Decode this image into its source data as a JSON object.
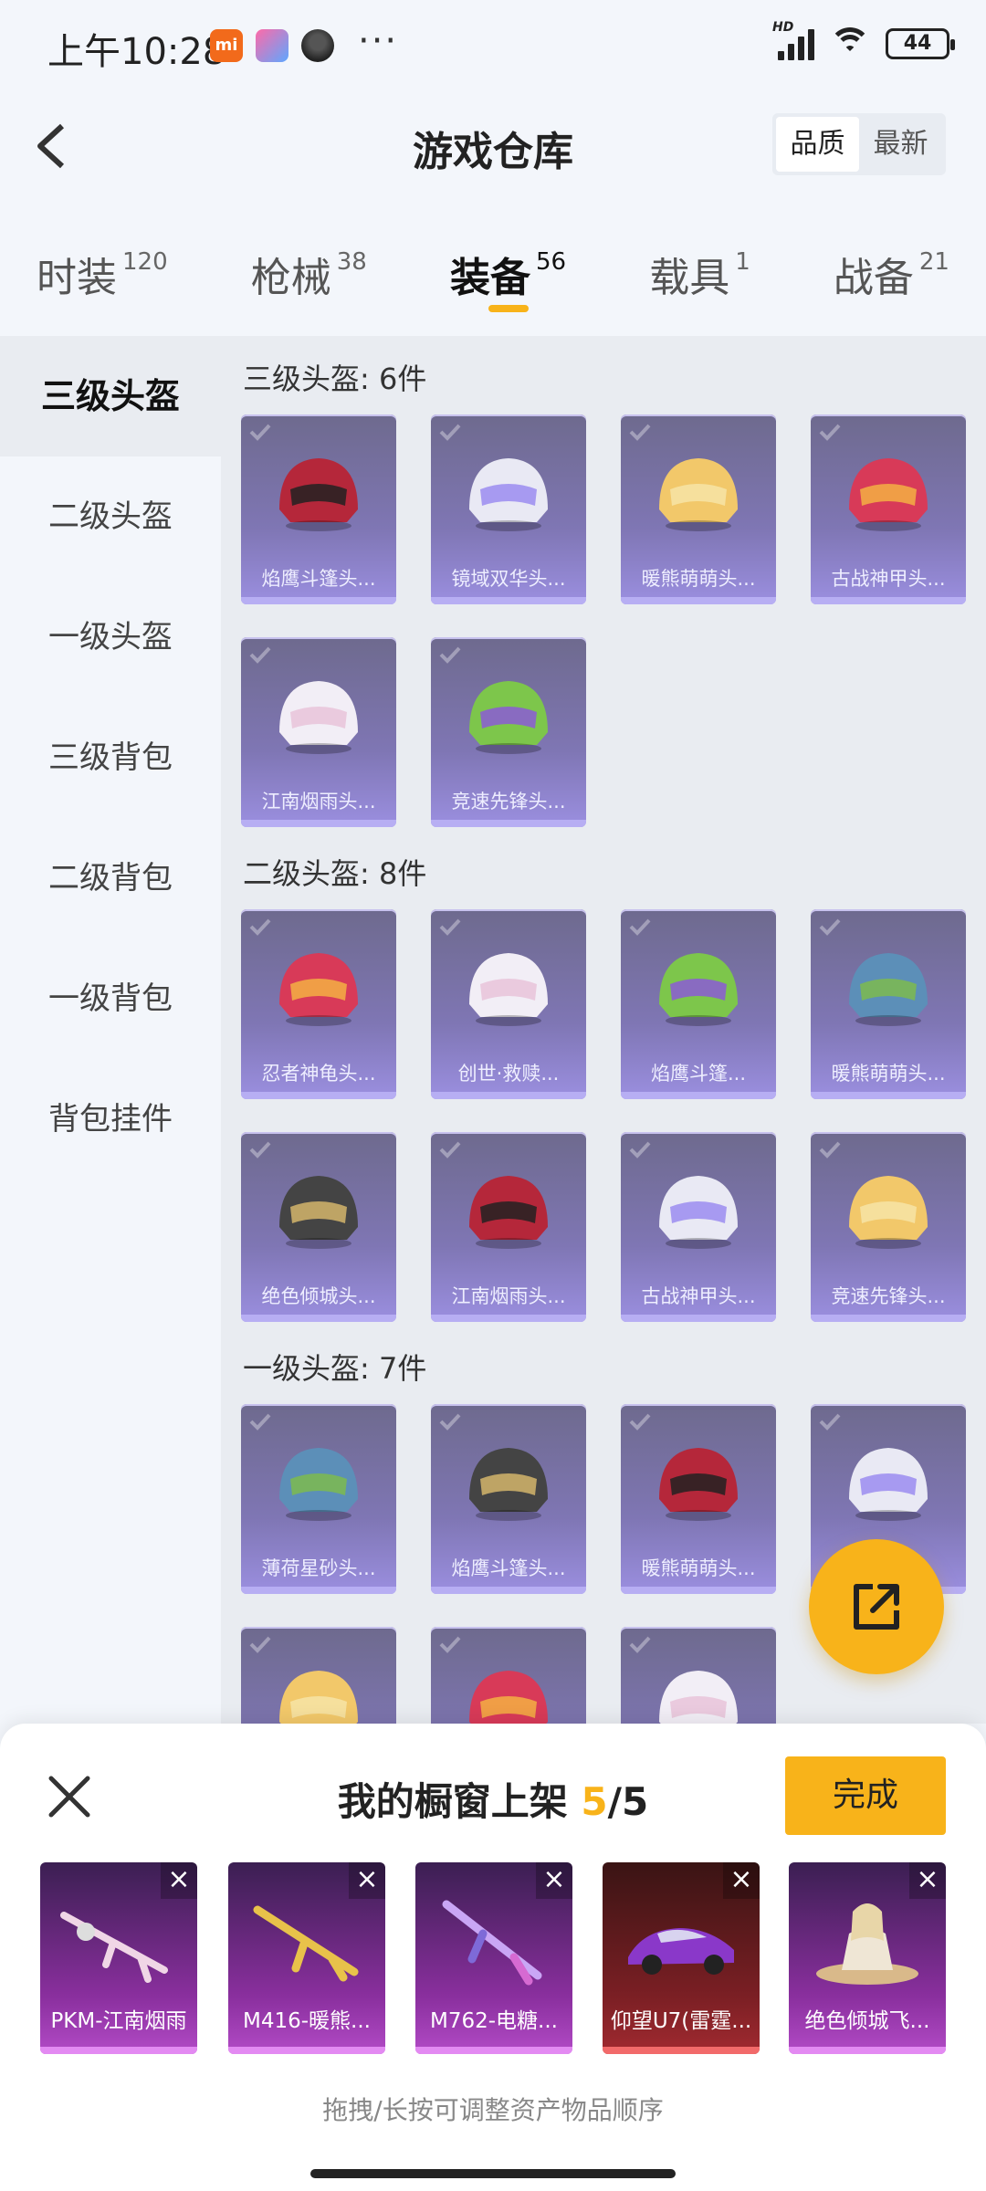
{
  "status_bar": {
    "time": "上午10:28",
    "dots": "···",
    "network_label": "HD",
    "battery": "44"
  },
  "header": {
    "title": "游戏仓库",
    "sort_options": [
      "品质",
      "最新"
    ],
    "sort_selected": "品质"
  },
  "tabs": [
    {
      "label": "时装",
      "count": "120"
    },
    {
      "label": "枪械",
      "count": "38"
    },
    {
      "label": "装备",
      "count": "56",
      "active": true
    },
    {
      "label": "载具",
      "count": "1"
    },
    {
      "label": "战备",
      "count": "21"
    }
  ],
  "sidebar": {
    "items": [
      "三级头盔",
      "二级头盔",
      "一级头盔",
      "三级背包",
      "二级背包",
      "一级背包",
      "背包挂件"
    ],
    "active": "三级头盔"
  },
  "sections": [
    {
      "title": "三级头盔: 6件",
      "items": [
        "焰鹰斗篷头...",
        "镜域双华头...",
        "暖熊萌萌头...",
        "古战神甲头...",
        "江南烟雨头...",
        "竞速先锋头..."
      ]
    },
    {
      "title": "二级头盔: 8件",
      "items": [
        "忍者神龟头...",
        "创世·救赎...",
        "焰鹰斗篷...",
        "暖熊萌萌头...",
        "绝色倾城头...",
        "江南烟雨头...",
        "古战神甲头...",
        "竞速先锋头..."
      ]
    },
    {
      "title": "一级头盔: 7件",
      "items": [
        "薄荷星砂头...",
        "焰鹰斗篷头...",
        "暖熊萌萌头...",
        "",
        "",
        "",
        ""
      ]
    }
  ],
  "panel": {
    "title_prefix": "我的橱窗上架",
    "count_current": "5",
    "count_sep": "/",
    "count_total": "5",
    "done_label": "完成",
    "items": [
      "PKM-江南烟雨",
      "M416-暖熊...",
      "M762-电糖...",
      "仰望U7(雷霆...",
      "绝色倾城飞..."
    ],
    "hint": "拖拽/长按可调整资产物品顺序"
  },
  "colors": {
    "accent": "#f8b31a",
    "card_purple": "#7f76b4",
    "shelf_purple": "#8a2f9e",
    "shelf_red": "#7b1f24"
  }
}
